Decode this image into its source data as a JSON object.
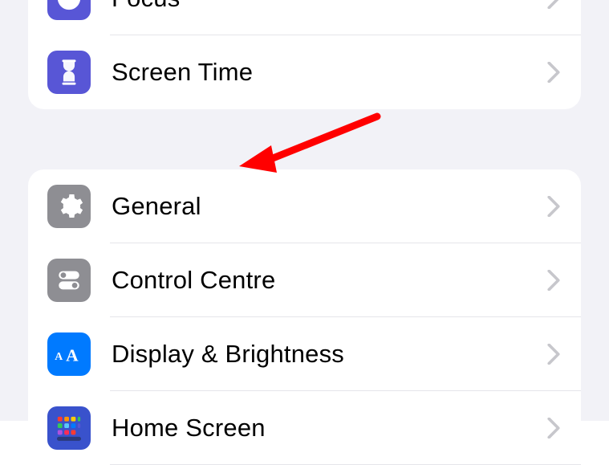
{
  "settings": {
    "group1": {
      "items": [
        {
          "label": "Focus",
          "icon": "focus-icon"
        },
        {
          "label": "Screen Time",
          "icon": "screentime-icon"
        }
      ]
    },
    "group2": {
      "items": [
        {
          "label": "General",
          "icon": "general-icon"
        },
        {
          "label": "Control Centre",
          "icon": "controlcentre-icon"
        },
        {
          "label": "Display & Brightness",
          "icon": "display-icon"
        },
        {
          "label": "Home Screen",
          "icon": "homescreen-icon"
        }
      ]
    }
  },
  "annotation": {
    "type": "arrow",
    "color": "#ff0000",
    "target": "General"
  }
}
